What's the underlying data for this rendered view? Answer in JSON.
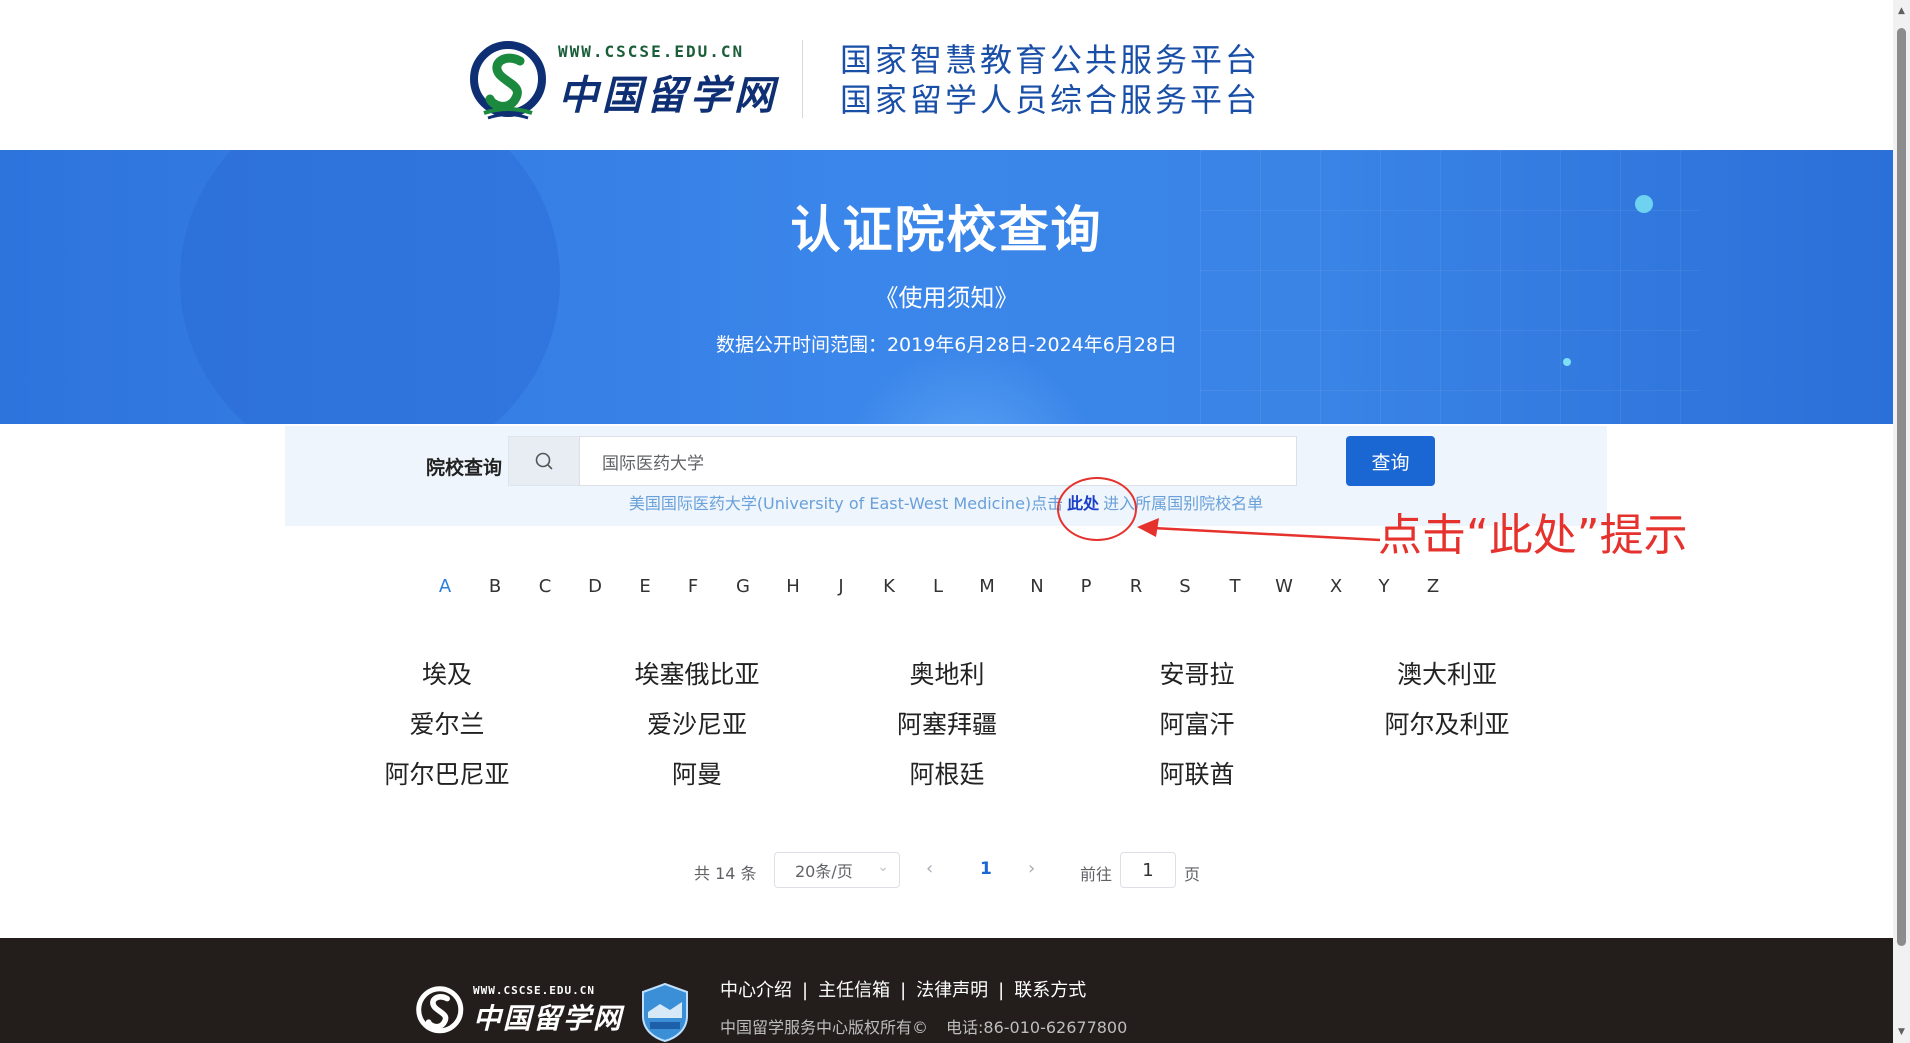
{
  "header": {
    "logo_url": "WWW.CSCSE.EDU.CN",
    "logo_cn": "中国留学网",
    "platform_line1": "国家智慧教育公共服务平台",
    "platform_line2": "国家留学人员综合服务平台"
  },
  "banner": {
    "title": "认证院校查询",
    "notice": "《使用须知》",
    "range": "数据公开时间范围：2019年6月28日-2024年6月28日"
  },
  "search": {
    "label": "院校查询",
    "value": "国际医药大学",
    "button": "查询",
    "hint_before": "美国国际医药大学(University of East-West Medicine)点击",
    "hint_link": "此处",
    "hint_after": "进入所属国别院校名单"
  },
  "annotation": {
    "text": "点击“此处”提示",
    "color": "#e5322d"
  },
  "alphabet": {
    "letters": [
      "A",
      "B",
      "C",
      "D",
      "E",
      "F",
      "G",
      "H",
      "J",
      "K",
      "L",
      "M",
      "N",
      "P",
      "R",
      "S",
      "T",
      "W",
      "X",
      "Y",
      "Z"
    ],
    "active": "A"
  },
  "countries": [
    "埃及",
    "埃塞俄比亚",
    "奥地利",
    "安哥拉",
    "澳大利亚",
    "爱尔兰",
    "爱沙尼亚",
    "阿塞拜疆",
    "阿富汗",
    "阿尔及利亚",
    "阿尔巴尼亚",
    "阿曼",
    "阿根廷",
    "阿联酋"
  ],
  "pagination": {
    "total": "共 14 条",
    "page_size": "20条/页",
    "current_page": "1",
    "goto_label": "前往",
    "goto_value": "1",
    "page_suffix": "页"
  },
  "footer": {
    "logo_url": "WWW.CSCSE.EDU.CN",
    "logo_cn": "中国留学网",
    "links": [
      "中心介绍",
      "主任信箱",
      "法律声明",
      "联系方式"
    ],
    "copyright": "中国留学服务中心版权所有©",
    "phone": "电话:86-010-62677800"
  },
  "colors": {
    "banner_blue": "#3b86ea",
    "button_blue": "#1a66d2",
    "footer_bg": "#231d1c",
    "annotation_red": "#e5322d"
  }
}
